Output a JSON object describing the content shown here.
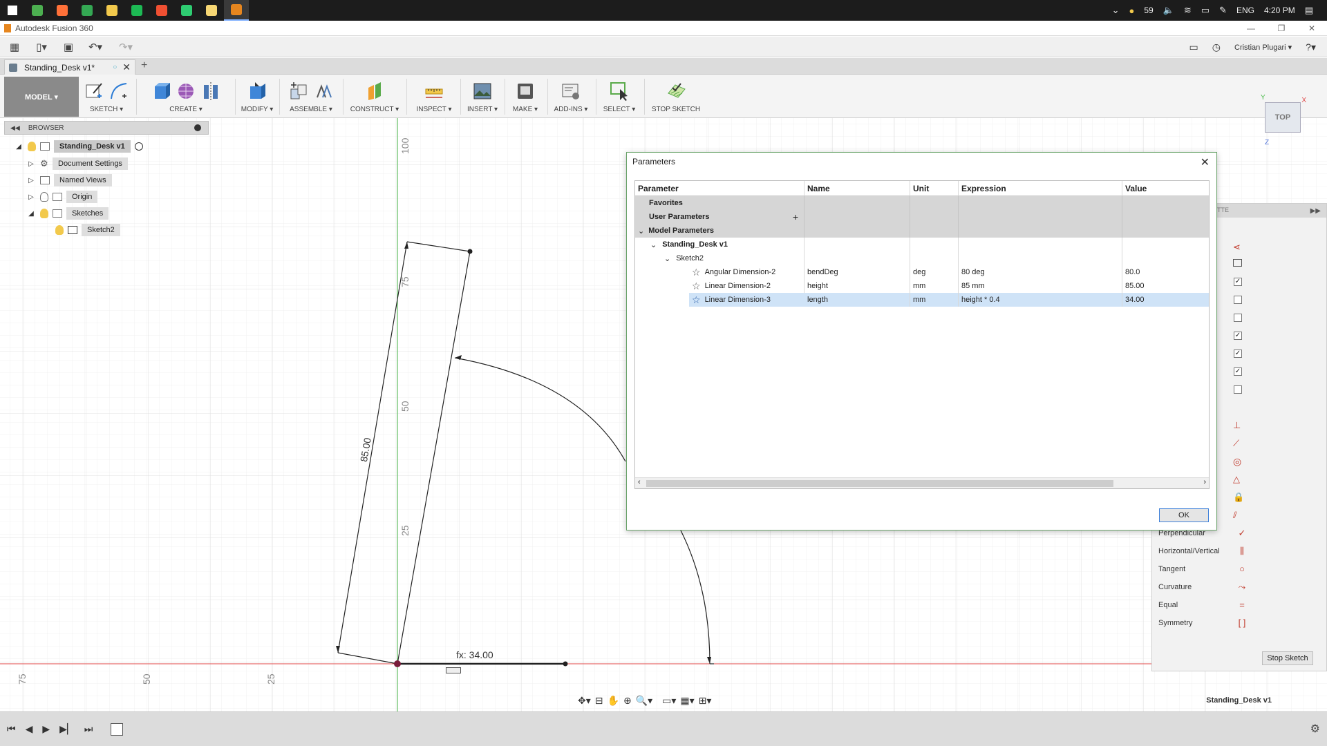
{
  "taskbar": {
    "apps": [
      {
        "name": "windows-start-icon",
        "color": "#ffffff"
      },
      {
        "name": "calendar-app-icon",
        "color": "#4caf50"
      },
      {
        "name": "firefox-icon",
        "color": "#ff7139"
      },
      {
        "name": "chrome-icon",
        "color": "#34a853"
      },
      {
        "name": "file-explorer-icon",
        "color": "#f2c94c"
      },
      {
        "name": "spotify-icon",
        "color": "#1db954"
      },
      {
        "name": "git-icon",
        "color": "#f05032"
      },
      {
        "name": "messaging-icon",
        "color": "#2ecc71"
      },
      {
        "name": "folder-icon",
        "color": "#f7d774"
      },
      {
        "name": "fusion360-icon",
        "color": "#e6861f"
      }
    ],
    "tray": {
      "weather": "59",
      "language": "ENG",
      "time": "4:20 PM"
    }
  },
  "titlebar": {
    "title": "Autodesk Fusion 360"
  },
  "qab": {
    "user": "Cristian Plugari ▾"
  },
  "doc_tab": {
    "title": "Standing_Desk v1*"
  },
  "ribbon": {
    "mode": "MODEL ▾",
    "groups": [
      {
        "id": "sketch",
        "label": "SKETCH ▾"
      },
      {
        "id": "create",
        "label": "CREATE ▾"
      },
      {
        "id": "modify",
        "label": "MODIFY ▾"
      },
      {
        "id": "assemble",
        "label": "ASSEMBLE ▾"
      },
      {
        "id": "construct",
        "label": "CONSTRUCT ▾"
      },
      {
        "id": "inspect",
        "label": "INSPECT ▾"
      },
      {
        "id": "insert",
        "label": "INSERT ▾"
      },
      {
        "id": "make",
        "label": "MAKE ▾"
      },
      {
        "id": "addins",
        "label": "ADD-INS ▾"
      },
      {
        "id": "select",
        "label": "SELECT ▾"
      },
      {
        "id": "stopsketch",
        "label": "STOP SKETCH"
      }
    ]
  },
  "browser": {
    "header": "BROWSER",
    "nodes": [
      {
        "label": "Standing_Desk v1"
      },
      {
        "label": "Document Settings"
      },
      {
        "label": "Named Views"
      },
      {
        "label": "Origin"
      },
      {
        "label": "Sketches"
      },
      {
        "label": "Sketch2"
      }
    ]
  },
  "canvas": {
    "axis_labels": [
      "100",
      "75",
      "50",
      "25"
    ],
    "bottom_ticks": [
      "75",
      "50",
      "25"
    ],
    "dim_label": "85.00",
    "fx_label": "fx: 34.00"
  },
  "dialog": {
    "title": "Parameters",
    "headers": {
      "parameter": "Parameter",
      "name": "Name",
      "unit": "Unit",
      "expression": "Expression",
      "value": "Value"
    },
    "favorites": "Favorites",
    "user_params": "User Parameters",
    "model_params": "Model Parameters",
    "component": "Standing_Desk v1",
    "sketch": "Sketch2",
    "rows": [
      {
        "parameter": "Angular Dimension-2",
        "name": "bendDeg",
        "unit": "deg",
        "expression": "80 deg",
        "value": "80.0"
      },
      {
        "parameter": "Linear Dimension-2",
        "name": "height",
        "unit": "mm",
        "expression": "85 mm",
        "value": "85.00"
      },
      {
        "parameter": "Linear Dimension-3",
        "name": "length",
        "unit": "mm",
        "expression": "height * 0.4",
        "value": "34.00"
      }
    ],
    "ok": "OK"
  },
  "palette": {
    "header": "TTE",
    "items": [
      "Perpendicular",
      "Horizontal/Vertical",
      "Tangent",
      "Curvature",
      "Equal",
      "Symmetry"
    ],
    "stop_sketch": "Stop Sketch",
    "checkboxes": [
      true,
      false,
      false,
      true,
      true,
      true,
      false
    ]
  },
  "viewcube": {
    "label": "TOP"
  },
  "bottom": {
    "doc_label": "Standing_Desk v1"
  }
}
